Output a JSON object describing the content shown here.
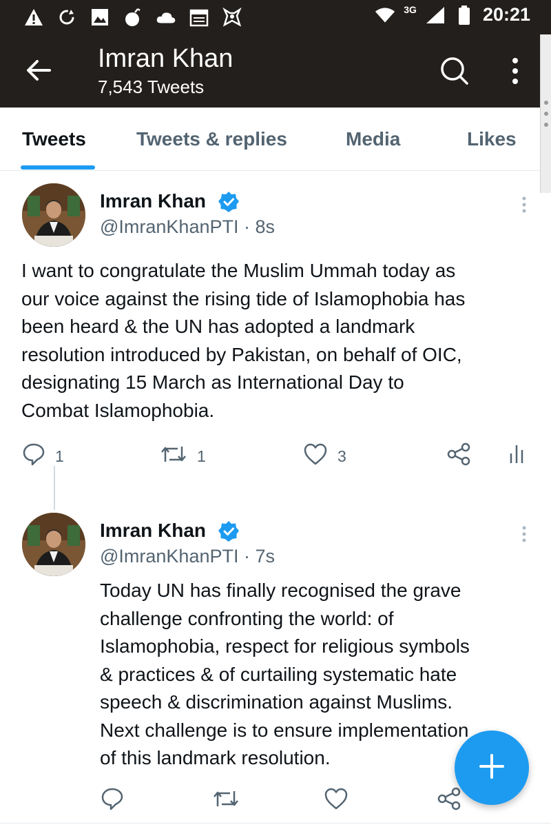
{
  "status_bar": {
    "time": "20:21",
    "network": "3G",
    "icons": [
      "warning-icon",
      "sync-icon",
      "image-icon",
      "bomb-icon",
      "cloud-icon",
      "calendar-icon",
      "app-icon",
      "wifi-icon",
      "signal-icon",
      "battery-icon"
    ]
  },
  "header": {
    "title": "Imran Khan",
    "subtitle": "7,543 Tweets",
    "back_icon": "back-arrow-icon",
    "search_icon": "search-icon",
    "more_icon": "more-vertical-icon"
  },
  "tabs": [
    {
      "label": "Tweets",
      "active": true
    },
    {
      "label": "Tweets & replies",
      "active": false
    },
    {
      "label": "Media",
      "active": false
    },
    {
      "label": "Likes",
      "active": false
    }
  ],
  "tweets": [
    {
      "name": "Imran Khan",
      "handle": "@ImranKhanPTI · 8s",
      "text_lines": [
        "I want to congratulate the Muslim Ummah today as",
        "our voice against the rising tide of Islamophobia has",
        "been heard & the UN has adopted a landmark",
        "resolution introduced by Pakistan, on behalf of OIC,",
        "designating 15 March as International Day to",
        "Combat Islamophobia."
      ],
      "replies": "1",
      "retweets": "1",
      "likes": "3"
    },
    {
      "name": "Imran Khan",
      "handle": "@ImranKhanPTI · 7s",
      "text_lines": [
        "Today UN has finally recognised the grave",
        "challenge confronting the world: of",
        "Islamophobia, respect for religious symbols",
        "& practices & of curtailing systematic hate",
        "speech & discrimination against Muslims.",
        "Next challenge is to ensure implementation",
        "of this landmark resolution."
      ],
      "replies": "",
      "retweets": "",
      "likes": ""
    }
  ],
  "colors": {
    "header_bg": "#231f1c",
    "accent": "#1d9bf0",
    "text": "#0f1419",
    "muted": "#536471"
  },
  "fab": {
    "icon": "plus-icon"
  }
}
